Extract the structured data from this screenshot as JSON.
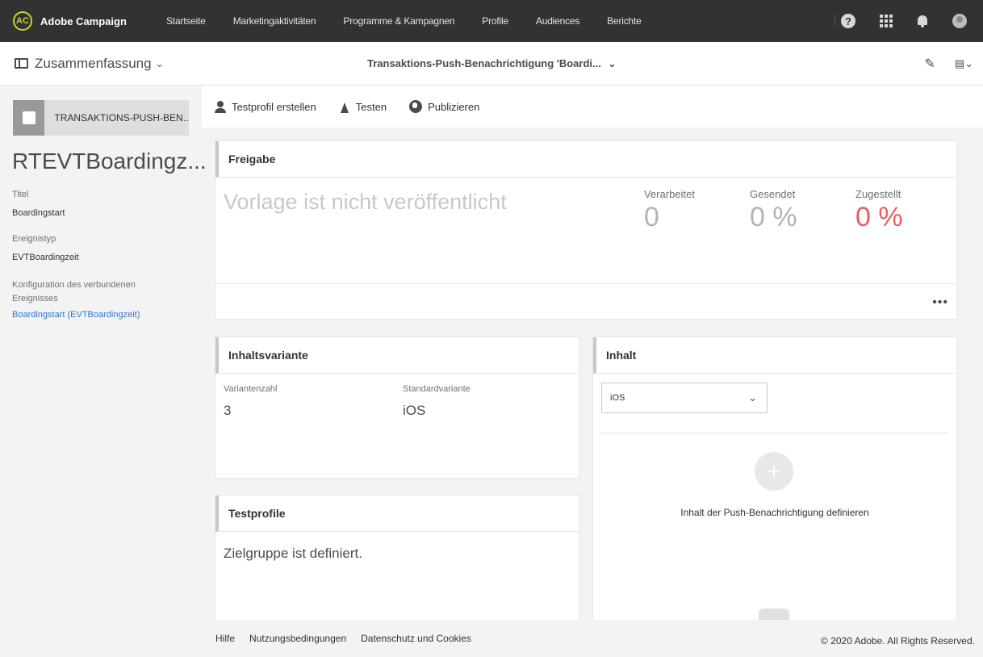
{
  "topnav": {
    "brand": "Adobe Campaign",
    "items": [
      "Startseite",
      "Marketingaktivitäten",
      "Programme & Kampagnen",
      "Profile",
      "Audiences",
      "Berichte"
    ],
    "icons": [
      "help-icon",
      "apps-grid-icon",
      "bell-icon",
      "avatar-icon"
    ]
  },
  "subbar": {
    "summary_label": "Zusammenfassung",
    "title": "Transaktions-Push-Benachrichtigung 'Boardi..."
  },
  "left_panel": {
    "header_label": "TRANSAKTIONS-PUSH-BEN...",
    "big_title": "RTEVTBoardingz...",
    "fields": [
      {
        "label": "Titel",
        "value": "Boardingstart"
      },
      {
        "label": "Ereignistyp",
        "value": "EVTBoardingzeit"
      },
      {
        "label": "Konfiguration des verbundenen Ereignisses",
        "value": "Boardingstart (EVTBoardingzeit)"
      }
    ]
  },
  "actions": {
    "test_profile": "Testprofil erstellen",
    "test": "Testen",
    "publish": "Publizieren"
  },
  "freigabe": {
    "title": "Freigabe",
    "status": "Vorlage ist nicht veröffentlicht",
    "stats": [
      {
        "label": "Verarbeitet",
        "value": "0"
      },
      {
        "label": "Gesendet",
        "value": "0 %"
      },
      {
        "label": "Zugestellt",
        "value": "0 %"
      }
    ],
    "more": "•••"
  },
  "inhaltsvariante": {
    "title": "Inhaltsvariante",
    "count_label": "Variantenzahl",
    "count_value": "3",
    "default_label": "Standardvariante",
    "default_value": "iOS"
  },
  "inhalt": {
    "title": "Inhalt",
    "selected": "iOS",
    "add_label": "Inhalt der Push-Benachrichtigung definieren"
  },
  "testprofile": {
    "title": "Testprofile",
    "text": "Zielgruppe ist definiert."
  },
  "footer": {
    "links": [
      "Hilfe",
      "Nutzungsbedingungen",
      "Datenschutz und Cookies"
    ],
    "copyright": "© 2020 Adobe. All Rights Reserved."
  },
  "colors": {
    "topbar": "#323232",
    "brand_accent": "#c7d629",
    "link": "#2d74da",
    "alert_red": "#ec5b62"
  }
}
